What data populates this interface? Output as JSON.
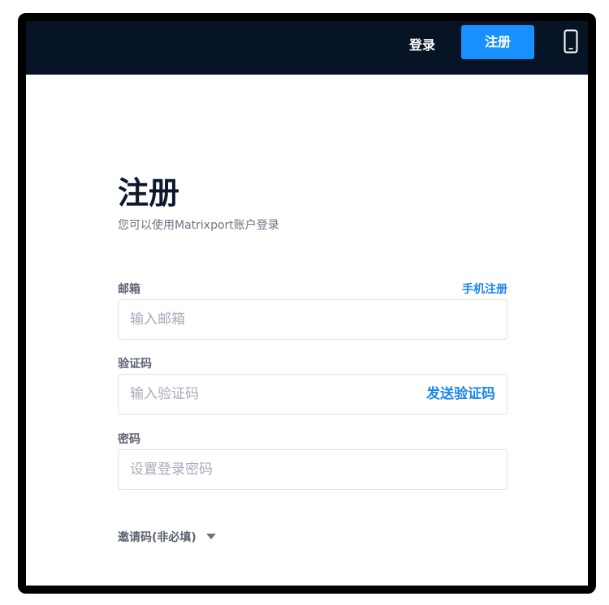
{
  "header": {
    "login_label": "登录",
    "register_label": "注册",
    "mobile_icon": "mobile-phone-icon"
  },
  "form": {
    "title": "注册",
    "subtitle": "您可以使用Matrixport账户登录",
    "switch_label": "手机注册",
    "email": {
      "label": "邮箱",
      "placeholder": "输入邮箱",
      "value": ""
    },
    "code": {
      "label": "验证码",
      "placeholder": "输入验证码",
      "value": "",
      "send_label": "发送验证码"
    },
    "password": {
      "label": "密码",
      "placeholder": "设置登录密码",
      "value": ""
    },
    "invite": {
      "label": "邀请码(非必填)",
      "icon": "chevron-down-icon"
    }
  },
  "colors": {
    "header_bg": "#061426",
    "accent": "#1890ff",
    "link": "#1a86f0",
    "title": "#0e1a2b",
    "label": "#5d6372",
    "placeholder": "#a6acb8",
    "input_border": "#dfe2ea"
  }
}
